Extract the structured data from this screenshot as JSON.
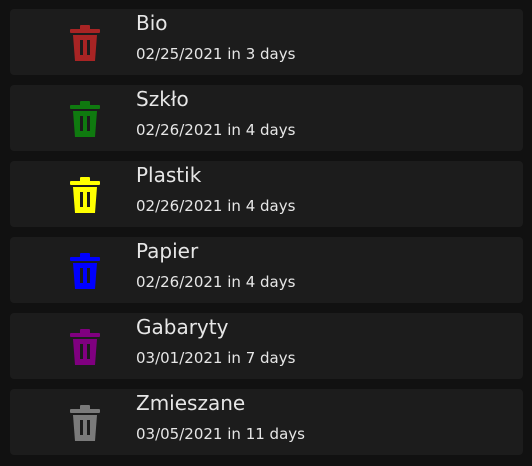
{
  "items": [
    {
      "name": "Bio",
      "date": "02/25/2021",
      "relative": "in 3 days",
      "color": "#a82424"
    },
    {
      "name": "Szkło",
      "date": "02/26/2021",
      "relative": "in 4 days",
      "color": "#0f7a0f"
    },
    {
      "name": "Plastik",
      "date": "02/26/2021",
      "relative": "in 4 days",
      "color": "#ffff00"
    },
    {
      "name": "Papier",
      "date": "02/26/2021",
      "relative": "in 4 days",
      "color": "#0000ff"
    },
    {
      "name": "Gabaryty",
      "date": "03/01/2021",
      "relative": "in 7 days",
      "color": "#800080"
    },
    {
      "name": "Zmieszane",
      "date": "03/05/2021",
      "relative": "in 11 days",
      "color": "#7a7a7a"
    }
  ],
  "icon": "trash-can-icon"
}
